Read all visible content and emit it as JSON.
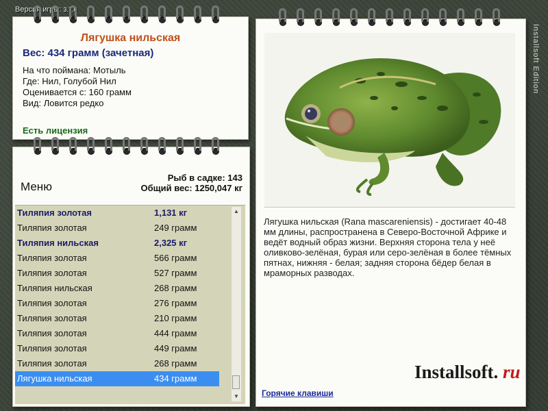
{
  "app": {
    "version_label": "Версия игры:",
    "version_number": "3.7.6",
    "sidebar_text": "Installsoft Edition"
  },
  "catch_info": {
    "title": "Лягушка нильская",
    "weight": "Вес: 434 грамм (зачетная)",
    "bait": "На что поймана: Мотыль",
    "location": "Где: Нил, Голубой Нил",
    "threshold": "Оценивается с: 160 грамм",
    "rarity": "Вид: Ловится редко",
    "license": "Есть лицензия"
  },
  "catch_list": {
    "menu_label": "Меню",
    "count_label": "Рыб в садке: 143",
    "total_label": "Общий вес: 1250,047 кг",
    "rows": [
      {
        "name": "Тиляпия золотая",
        "weight": "1,131 кг",
        "bold": true
      },
      {
        "name": "Тиляпия золотая",
        "weight": "249 грамм",
        "bold": false
      },
      {
        "name": "Тиляпия нильская",
        "weight": "2,325 кг",
        "bold": true
      },
      {
        "name": "Тиляпия золотая",
        "weight": "566 грамм",
        "bold": false
      },
      {
        "name": "Тиляпия золотая",
        "weight": "527 грамм",
        "bold": false
      },
      {
        "name": "Тиляпия нильская",
        "weight": "268 грамм",
        "bold": false
      },
      {
        "name": "Тиляпия золотая",
        "weight": "276 грамм",
        "bold": false
      },
      {
        "name": "Тиляпия золотая",
        "weight": "210 грамм",
        "bold": false
      },
      {
        "name": "Тиляпия золотая",
        "weight": "444 грамм",
        "bold": false
      },
      {
        "name": "Тиляпия золотая",
        "weight": "449 грамм",
        "bold": false
      },
      {
        "name": "Тиляпия золотая",
        "weight": "268 грамм",
        "bold": false
      },
      {
        "name": "Лягушка нильская",
        "weight": "434 грамм",
        "bold": false,
        "selected": true
      }
    ]
  },
  "detail": {
    "description": "Лягушка нильская (Rana mascareniensis) - достигает 40-48 мм длины, распространена в Северо-Восточной Африке и ведёт водный образ жизни. Верхняя сторона тела у неё оливково-зелёная, бурая или серо-зелёная в более тёмных пятнах, нижняя - белая; задняя сторона бёдер белая в мраморных разводах.",
    "hotkeys_link": "Горячие клавиши",
    "logo_main": "Installsoft.",
    "logo_suffix": "ru"
  },
  "colors": {
    "title_orange": "#c0501a",
    "weight_blue": "#1a2a7a",
    "license_green": "#1a6a1a",
    "selection_blue": "#3b8ef0",
    "list_bg": "#d4d5b8"
  }
}
